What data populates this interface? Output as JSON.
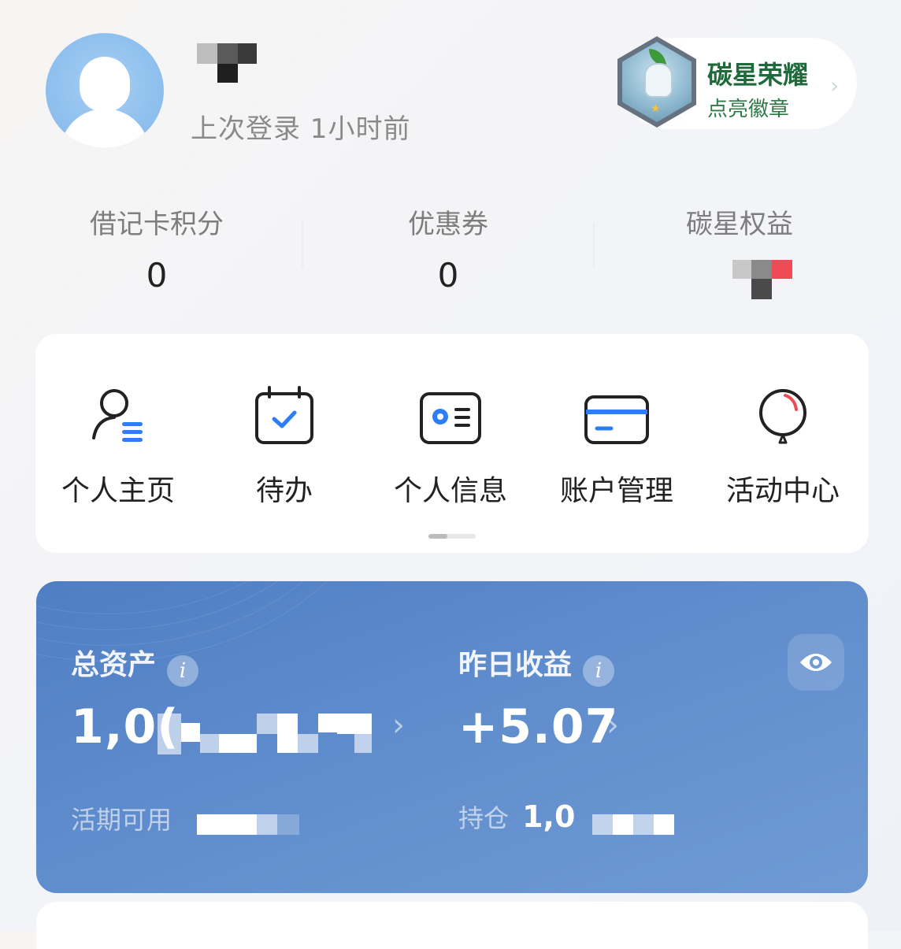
{
  "header": {
    "last_login": "上次登录 1小时前"
  },
  "badge": {
    "title": "碳星荣耀",
    "subtitle": "点亮徽章"
  },
  "stats": [
    {
      "label": "借记卡积分",
      "value": "0"
    },
    {
      "label": "优惠券",
      "value": "0"
    },
    {
      "label": "碳星权益",
      "value": ""
    }
  ],
  "menu": [
    {
      "label": "个人主页",
      "icon": "person-list-icon"
    },
    {
      "label": "待办",
      "icon": "calendar-check-icon"
    },
    {
      "label": "个人信息",
      "icon": "id-card-icon"
    },
    {
      "label": "账户管理",
      "icon": "card-icon"
    },
    {
      "label": "活动中心",
      "icon": "balloon-icon"
    }
  ],
  "assets": {
    "total_label": "总资产",
    "total_value": "1,0(",
    "yesterday_label": "昨日收益",
    "yesterday_value": "+5.07",
    "available_label": "活期可用",
    "holding_label": "持仓",
    "holding_value": "1,0"
  },
  "colors": {
    "asset_card": "#5f8ccc",
    "badge_text": "#1f6a3a",
    "accent_blue": "#2f7df6"
  }
}
